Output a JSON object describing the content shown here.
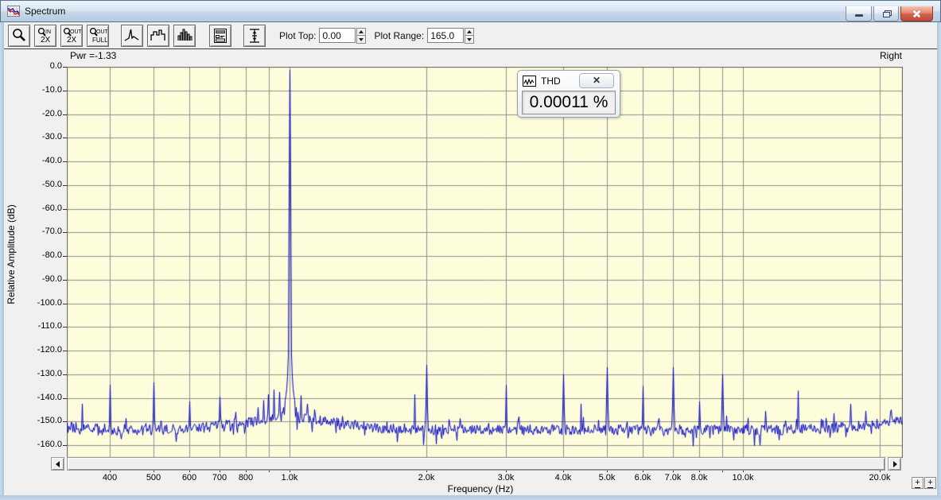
{
  "window": {
    "title": "Spectrum"
  },
  "toolbar": {
    "zoom_in": {
      "top": "IN",
      "bottom": "2X"
    },
    "zoom_out": {
      "top": "OUT",
      "bottom": "2X"
    },
    "zoom_full": {
      "top": "OUT",
      "bottom": "FULL"
    },
    "plot_top": {
      "label": "Plot Top:",
      "value": "0.00"
    },
    "plot_range": {
      "label": "Plot Range:",
      "value": "165.0"
    }
  },
  "plot_header": {
    "power": "Pwr =-1.33",
    "channel": "Right"
  },
  "thd_panel": {
    "title": "THD",
    "value": "0.00011 %",
    "close_glyph": "✕"
  },
  "corner_buttons": {
    "glyph": "+"
  },
  "chart_data": {
    "type": "line",
    "title": "Spectrum",
    "xlabel": "Frequency (Hz)",
    "ylabel": "Relative Amplitude (dB)",
    "x_scale": "log",
    "x_range_hz": [
      322,
      22400
    ],
    "y_range_db": [
      0,
      -165
    ],
    "grid": true,
    "legend": "none",
    "plot_bg": "#fdfcdb",
    "grid_color": "#8f8f8f",
    "frame_color": "#5f5f5f",
    "trace_color": "#0000c8",
    "noise_floor_db": -153.5,
    "noise_jitter_db": 4.5,
    "fundamental_hz": 1000,
    "fundamental_db": -1.33,
    "thd_percent": 0.00011,
    "main_skirt": [
      [
        1,
        -52
      ],
      [
        2,
        -122
      ],
      [
        3,
        -131
      ],
      [
        4,
        -136
      ],
      [
        5,
        -139
      ],
      [
        6,
        -141
      ],
      [
        8,
        -144
      ],
      [
        10,
        -146
      ],
      [
        13,
        -148
      ],
      [
        16,
        -150
      ]
    ],
    "peaks": [
      [
        347,
        -142.5
      ],
      [
        400,
        -134.5
      ],
      [
        500,
        -133.5
      ],
      [
        600,
        -141.5
      ],
      [
        700,
        -139.5
      ],
      [
        757,
        -146
      ],
      [
        848,
        -144
      ],
      [
        872,
        -141
      ],
      [
        896,
        -138.5
      ],
      [
        920,
        -136.5
      ],
      [
        948,
        -137.5
      ],
      [
        1000,
        -1.33
      ],
      [
        1055,
        -139
      ],
      [
        1090,
        -142.5
      ],
      [
        1130,
        -145
      ],
      [
        1880,
        -138.5
      ],
      [
        2000,
        -126
      ],
      [
        3000,
        -134.5
      ],
      [
        4000,
        -130
      ],
      [
        4380,
        -142.5
      ],
      [
        5000,
        -127
      ],
      [
        6000,
        -135
      ],
      [
        7000,
        -127
      ],
      [
        8000,
        -141.5
      ],
      [
        9000,
        -130
      ],
      [
        9160,
        -147.5
      ],
      [
        11200,
        -145.5
      ],
      [
        13200,
        -137
      ],
      [
        15800,
        -146.5
      ],
      [
        17200,
        -142.5
      ],
      [
        18600,
        -145.5
      ],
      [
        21100,
        -146
      ]
    ],
    "x_ticks": [
      {
        "hz": 400,
        "label": "400"
      },
      {
        "hz": 500,
        "label": "500"
      },
      {
        "hz": 600,
        "label": "600"
      },
      {
        "hz": 700,
        "label": "700"
      },
      {
        "hz": 800,
        "label": "800"
      },
      {
        "hz": 900,
        "label": ""
      },
      {
        "hz": 1000,
        "label": "1.0k"
      },
      {
        "hz": 2000,
        "label": "2.0k"
      },
      {
        "hz": 3000,
        "label": "3.0k"
      },
      {
        "hz": 4000,
        "label": "4.0k"
      },
      {
        "hz": 5000,
        "label": "5.0k"
      },
      {
        "hz": 6000,
        "label": "6.0k"
      },
      {
        "hz": 7000,
        "label": "7.0k"
      },
      {
        "hz": 8000,
        "label": "8.0k"
      },
      {
        "hz": 9000,
        "label": ""
      },
      {
        "hz": 10000,
        "label": "10.0k"
      },
      {
        "hz": 20000,
        "label": "20.0k"
      }
    ],
    "y_ticks": [
      {
        "db": 0,
        "label": "0.0"
      },
      {
        "db": -10,
        "label": "-10.0"
      },
      {
        "db": -20,
        "label": "-20.0"
      },
      {
        "db": -30,
        "label": "-30.0"
      },
      {
        "db": -40,
        "label": "-40.0"
      },
      {
        "db": -50,
        "label": "-50.0"
      },
      {
        "db": -60,
        "label": "-60.0"
      },
      {
        "db": -70,
        "label": "-70.0"
      },
      {
        "db": -80,
        "label": "-80.0"
      },
      {
        "db": -90,
        "label": "-90.0"
      },
      {
        "db": -100,
        "label": "-100.0"
      },
      {
        "db": -110,
        "label": "-110.0"
      },
      {
        "db": -120,
        "label": "-120.0"
      },
      {
        "db": -130,
        "label": "-130.0"
      },
      {
        "db": -140,
        "label": "-140.0"
      },
      {
        "db": -150,
        "label": "-150.0"
      },
      {
        "db": -160,
        "label": "-160.0"
      }
    ]
  }
}
